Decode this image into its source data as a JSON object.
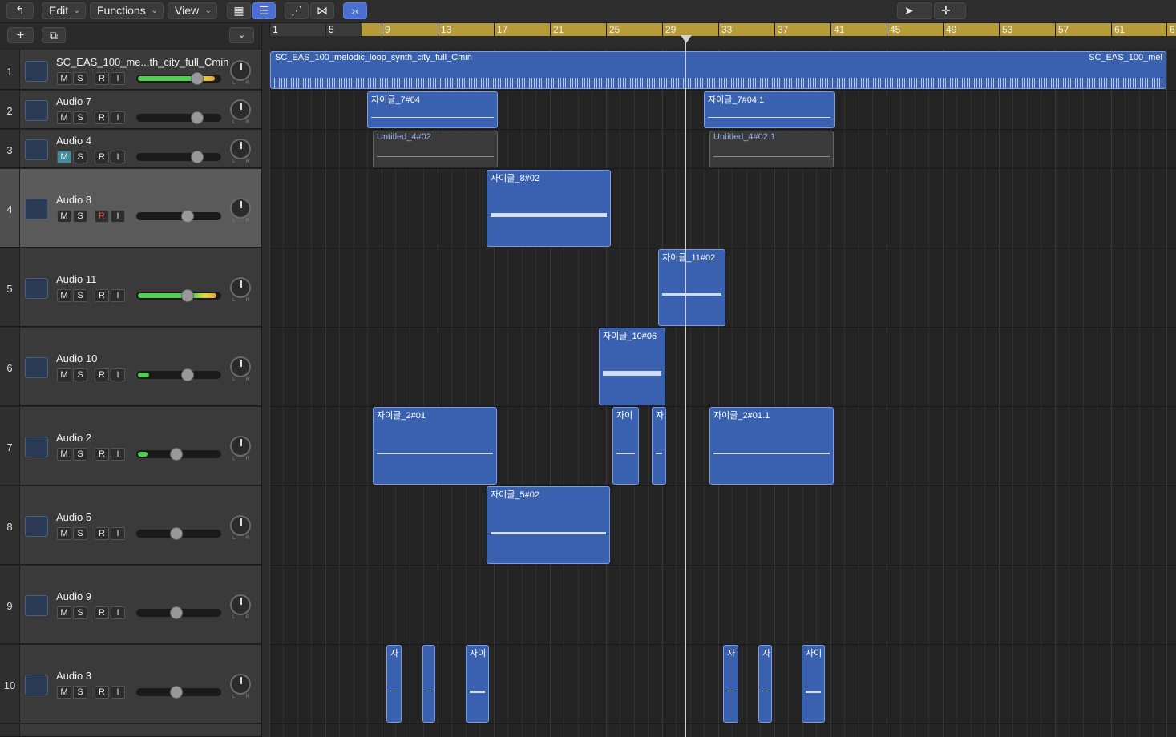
{
  "toolbar": {
    "edit_label": "Edit",
    "functions_label": "Functions",
    "view_label": "View"
  },
  "ruler": {
    "bars": [
      "1",
      "5",
      "9",
      "13",
      "17",
      "21",
      "25",
      "29",
      "33",
      "37",
      "41",
      "45",
      "49",
      "53",
      "57",
      "61",
      "6"
    ]
  },
  "tracks": [
    {
      "num": "1",
      "name": "SC_EAS_100_me...th_city_full_Cmin",
      "m": "M",
      "s": "S",
      "r": "R",
      "i": "I"
    },
    {
      "num": "2",
      "name": "Audio 7",
      "m": "M",
      "s": "S",
      "r": "R",
      "i": "I"
    },
    {
      "num": "3",
      "name": "Audio 4",
      "m": "M",
      "s": "S",
      "r": "R",
      "i": "I"
    },
    {
      "num": "4",
      "name": "Audio 8",
      "m": "M",
      "s": "S",
      "r": "R",
      "i": "I"
    },
    {
      "num": "5",
      "name": "Audio 11",
      "m": "M",
      "s": "S",
      "r": "R",
      "i": "I"
    },
    {
      "num": "6",
      "name": "Audio 10",
      "m": "M",
      "s": "S",
      "r": "R",
      "i": "I"
    },
    {
      "num": "7",
      "name": "Audio 2",
      "m": "M",
      "s": "S",
      "r": "R",
      "i": "I"
    },
    {
      "num": "8",
      "name": "Audio 5",
      "m": "M",
      "s": "S",
      "r": "R",
      "i": "I"
    },
    {
      "num": "9",
      "name": "Audio 9",
      "m": "M",
      "s": "S",
      "r": "R",
      "i": "I"
    },
    {
      "num": "10",
      "name": "Audio 3",
      "m": "M",
      "s": "S",
      "r": "R",
      "i": "I"
    }
  ],
  "regions": {
    "r1a": "SC_EAS_100_melodic_loop_synth_city_full_Cmin",
    "r1b": "SC_EAS_100_mel",
    "r2a": "자이글_7#04",
    "r2b": "자이글_7#04.1",
    "r3a": "Untitled_4#02",
    "r3b": "Untitled_4#02.1",
    "r4a": "자이글_8#02",
    "r5a": "자이글_11#02",
    "r6a": "자이글_10#06",
    "r7a": "자이글_2#01",
    "r7b": "자이",
    "r7c": "자",
    "r7d": "자이글_2#01.1",
    "r8a": "자이글_5#02",
    "r10a": "자",
    "r10c": "자이",
    "r10d": "자",
    "r10e": "자",
    "r10f": "자이"
  }
}
